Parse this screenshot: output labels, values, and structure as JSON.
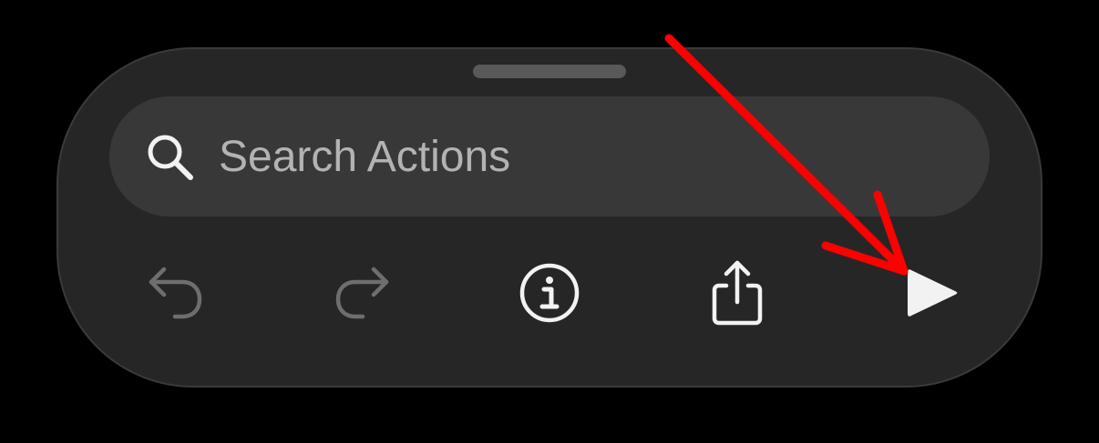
{
  "search": {
    "placeholder": "Search Actions"
  },
  "toolbar": {
    "undo_icon": "arrow-uturn-backward",
    "redo_icon": "arrow-uturn-forward",
    "info_icon": "info-circle",
    "share_icon": "square-and-arrow-up",
    "run_icon": "play-fill"
  },
  "colors": {
    "background": "#000000",
    "sheet": "#262626",
    "search_field": "#383838",
    "disabled_icon": "#6e6e6e",
    "enabled_icon": "#f2f2f2",
    "annotation_arrow": "#ff0000"
  }
}
